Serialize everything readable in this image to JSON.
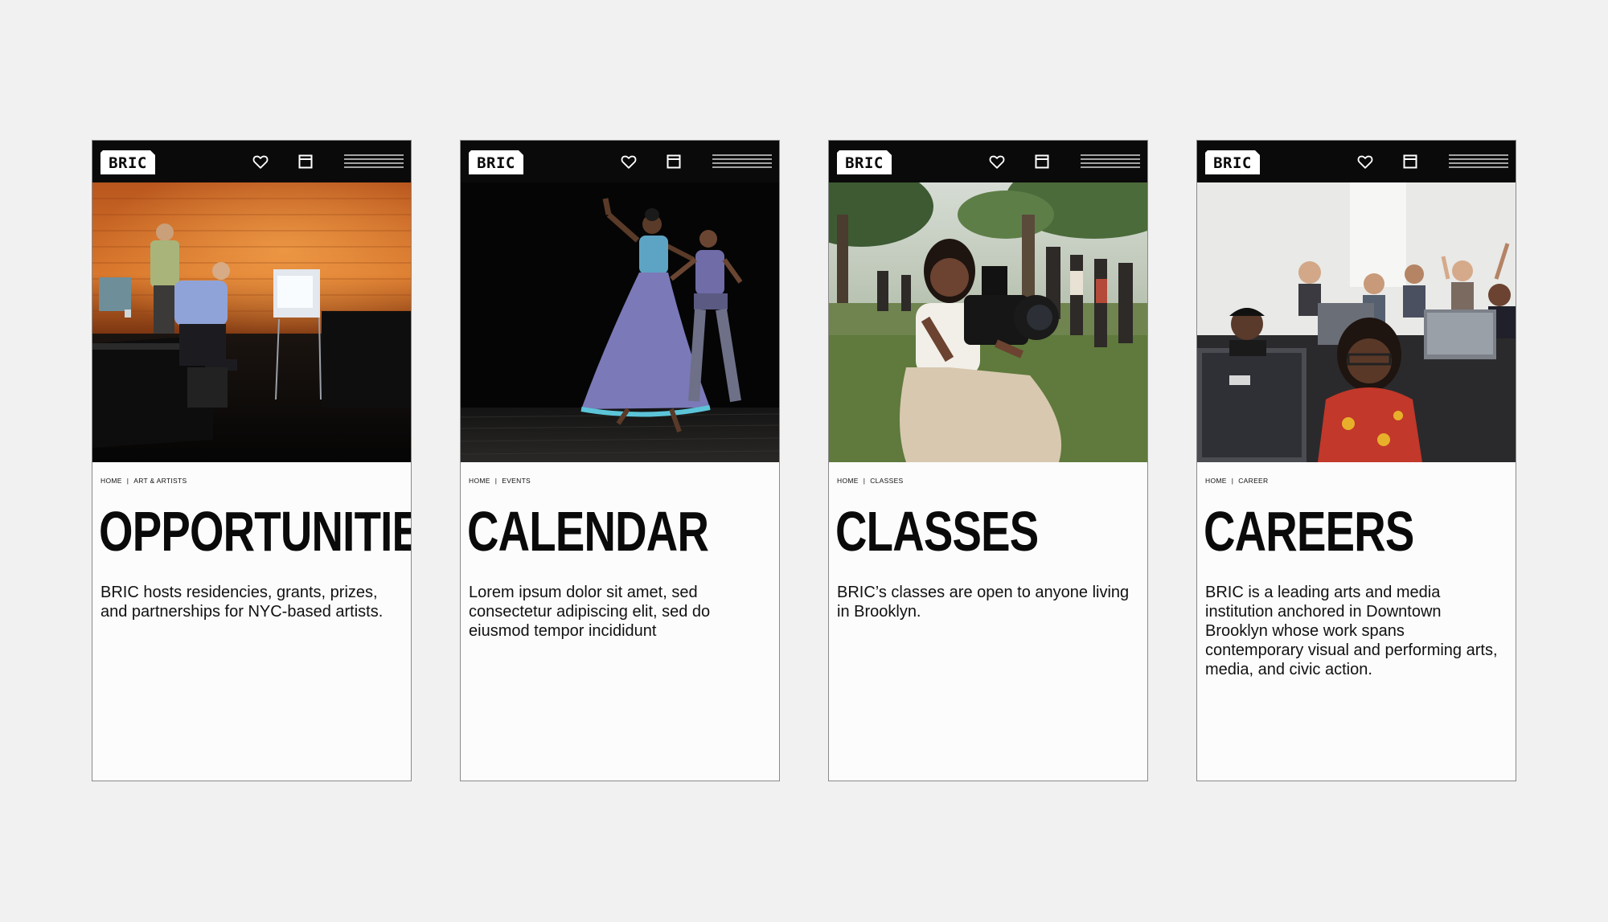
{
  "brand": {
    "logo_text": "BRIC"
  },
  "icons": {
    "favorite": "heart-icon",
    "calendar": "calendar-icon",
    "menu": "hamburger-menu-icon"
  },
  "colors": {
    "background": "#f1f1f1",
    "topbar": "#0a0a0a",
    "card": "#fcfcfc",
    "text": "#0a0a0a"
  },
  "screens": [
    {
      "breadcrumb": [
        "HOME",
        "ART & ARTISTS"
      ],
      "breadcrumb_separator": "|",
      "title": "OPPORTUNITIES",
      "description": "BRIC hosts residencies, grants, prizes, and partnerships for NYC-based artists.",
      "image": "theater-stage-photo"
    },
    {
      "breadcrumb": [
        "HOME",
        "EVENTS"
      ],
      "breadcrumb_separator": "|",
      "title": "CALENDAR",
      "description": "Lorem ipsum dolor sit amet, sed consectetur adipiscing elit, sed do eiusmod tempor incididunt",
      "image": "dance-performance-photo"
    },
    {
      "breadcrumb": [
        "HOME",
        "CLASSES"
      ],
      "breadcrumb_separator": "|",
      "title": "CLASSES",
      "description": "BRIC’s classes are open to anyone living in Brooklyn.",
      "image": "camera-operator-photo"
    },
    {
      "breadcrumb": [
        "HOME",
        "CAREER"
      ],
      "breadcrumb_separator": "|",
      "title": "CAREERS",
      "description": "BRIC is a leading arts and media institution anchored in Downtown Brooklyn whose work spans contemporary visual and performing arts, media, and civic action.",
      "image": "computer-lab-photo"
    }
  ]
}
